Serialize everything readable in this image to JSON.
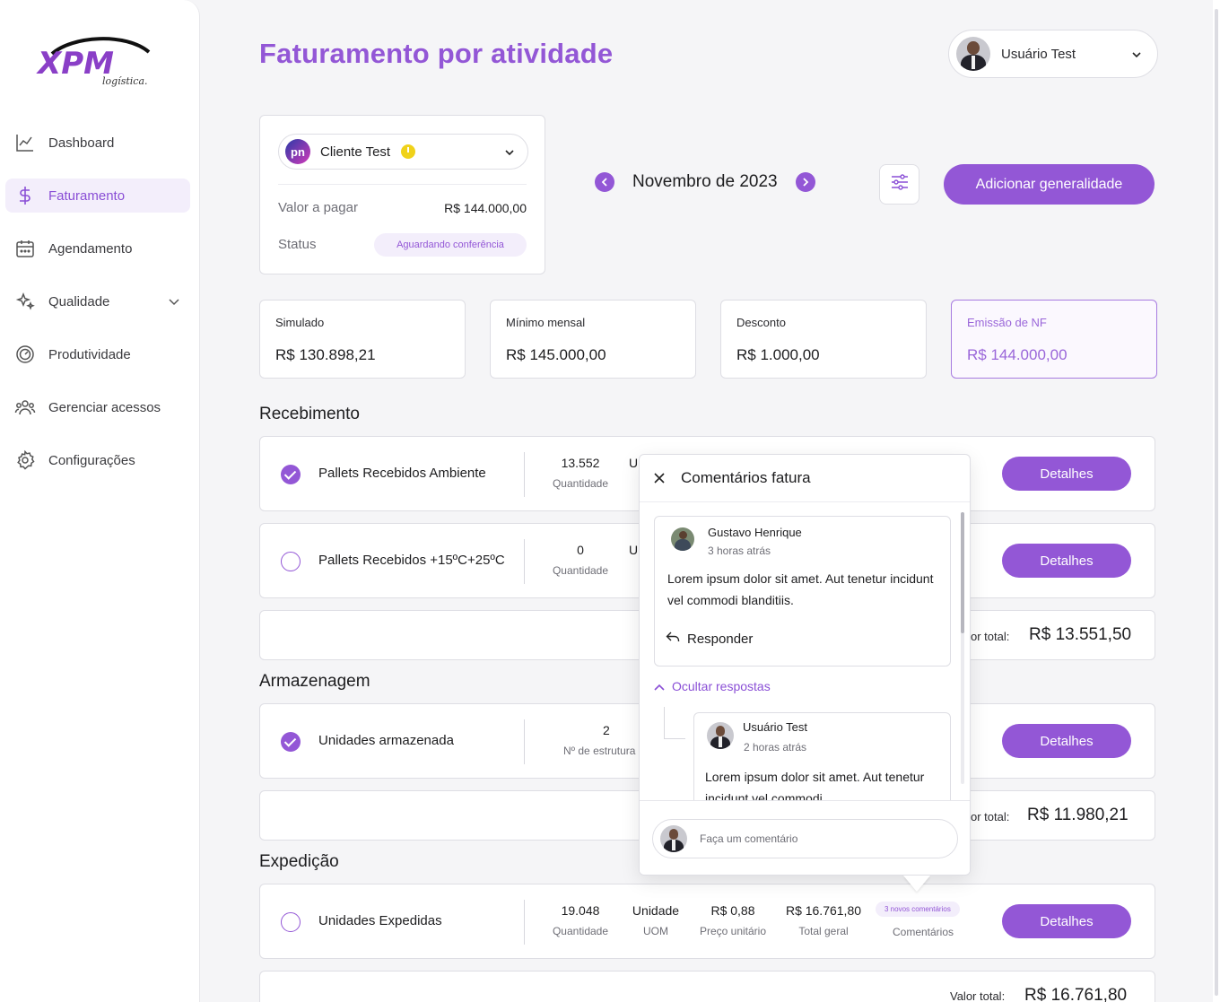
{
  "brand": {
    "logo_text": "XPM",
    "logo_sub": "logística.",
    "accent": "#9357d6"
  },
  "sidebar": {
    "items": [
      {
        "label": "Dashboard",
        "icon": "chart-icon"
      },
      {
        "label": "Faturamento",
        "icon": "dollar-icon",
        "active": true
      },
      {
        "label": "Agendamento",
        "icon": "calendar-icon"
      },
      {
        "label": "Qualidade",
        "icon": "sparkle-icon",
        "expandable": true
      },
      {
        "label": "Produtividade",
        "icon": "gauge-icon"
      },
      {
        "label": "Gerenciar acessos",
        "icon": "users-icon"
      },
      {
        "label": "Configurações",
        "icon": "gear-icon"
      }
    ]
  },
  "header": {
    "title": "Faturamento por atividade",
    "user_name": "Usuário Test"
  },
  "client": {
    "name": "Cliente Test",
    "logo_text": "pn",
    "amount_label": "Valor a pagar",
    "amount_value": "R$ 144.000,00",
    "status_label": "Status",
    "status_value": "Aguardando conferência"
  },
  "period": {
    "month": "Novembro de 2023"
  },
  "actions": {
    "add_label": "Adicionar generalidade"
  },
  "kpis": [
    {
      "label": "Simulado",
      "value": "R$ 130.898,21"
    },
    {
      "label": "Mínimo mensal",
      "value": "R$ 145.000,00"
    },
    {
      "label": "Desconto",
      "value": "R$ 1.000,00"
    },
    {
      "label": "Emissão de NF",
      "value": "R$ 144.000,00",
      "highlight": true
    }
  ],
  "sections": {
    "recebimento": {
      "title": "Recebimento",
      "rows": [
        {
          "name": "Pallets Recebidos Ambiente",
          "checked": true,
          "qty": "13.552",
          "qty_label": "Quantidade",
          "uom_partial": "Ur"
        },
        {
          "name": "Pallets Recebidos +15ºC+25ºC",
          "checked": false,
          "qty": "0",
          "qty_label": "Quantidade",
          "uom_partial": "Ur"
        }
      ],
      "total_label": "or total:",
      "total_value": "R$ 13.551,50"
    },
    "armazenagem": {
      "title": "Armazenagem",
      "rows": [
        {
          "name": "Unidades armazenada",
          "checked": true,
          "qty": "2",
          "qty_label": "Nº de estrutura"
        }
      ],
      "total_label": "or total:",
      "total_value": "R$ 11.980,21"
    },
    "expedicao": {
      "title": "Expedição",
      "rows": [
        {
          "name": "Unidades Expedidas",
          "checked": false,
          "qty": "19.048",
          "qty_label": "Quantidade",
          "uom": "Unidade",
          "uom_label": "UOM",
          "unit_price": "R$ 0,88",
          "unit_price_label": "Preço unitário",
          "total": "R$ 16.761,80",
          "total_label": "Total geral",
          "comments_badge": "3 novos comentários",
          "comments_label": "Comentários"
        }
      ],
      "total_label": "Valor total:",
      "total_value": "R$ 16.761,80"
    }
  },
  "details_label": "Detalhes",
  "comments_panel": {
    "title": "Comentários fatura",
    "comment": {
      "author": "Gustavo Henrique",
      "time": "3 horas atrás",
      "text": "Lorem ipsum dolor sit amet. Aut tenetur incidunt vel commodi blanditiis.",
      "reply_label": "Responder"
    },
    "toggle_label": "Ocultar respostas",
    "reply": {
      "author": "Usuário Test",
      "time": "2 horas atrás",
      "text": "Lorem ipsum dolor sit amet. Aut tenetur incidunt vel commodi"
    },
    "input_placeholder": "Faça um comentário"
  }
}
